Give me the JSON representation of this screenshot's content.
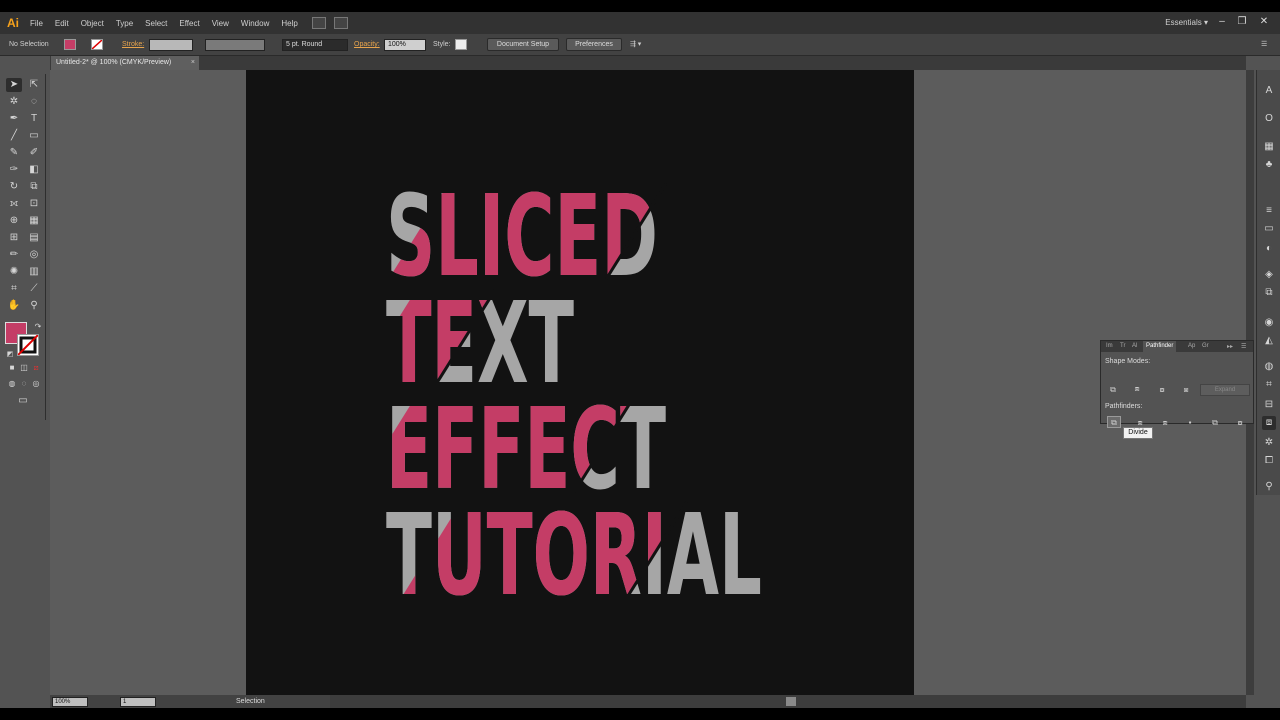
{
  "app": {
    "logo": "Ai",
    "menu": [
      "File",
      "Edit",
      "Object",
      "Type",
      "Select",
      "Effect",
      "View",
      "Window",
      "Help"
    ],
    "workspace": "Essentials",
    "window_buttons": [
      "–",
      "❐",
      "✕"
    ]
  },
  "control_bar": {
    "selection": "No Selection",
    "stroke_label": "Stroke:",
    "brush": "5 pt. Round",
    "opacity_label": "Opacity:",
    "opacity_value": "100%",
    "style_label": "Style:",
    "document_setup": "Document Setup",
    "preferences": "Preferences"
  },
  "document": {
    "tab_title": "Untitled-2* @ 100% (CMYK/Preview)",
    "close": "×"
  },
  "artwork": {
    "lines": [
      "SLICED",
      "TEXT",
      "EFFECT",
      "TUTORIAL"
    ],
    "colors": {
      "gray": "#a6a6a6",
      "pink": "#c43d66",
      "background": "#121212"
    }
  },
  "status_bar": {
    "zoom": "100%",
    "page": "1",
    "tool": "Selection"
  },
  "pathfinder": {
    "tabs": [
      "Im",
      "Tr",
      "Al",
      "Pathfinder",
      "Ap",
      "Gr"
    ],
    "shape_modes_label": "Shape Modes:",
    "pathfinders_label": "Pathfinders:",
    "expand": "Expand",
    "tooltip": "Divide"
  },
  "colors": {
    "fill": "#c43d66",
    "accent": "#f7a21b"
  }
}
